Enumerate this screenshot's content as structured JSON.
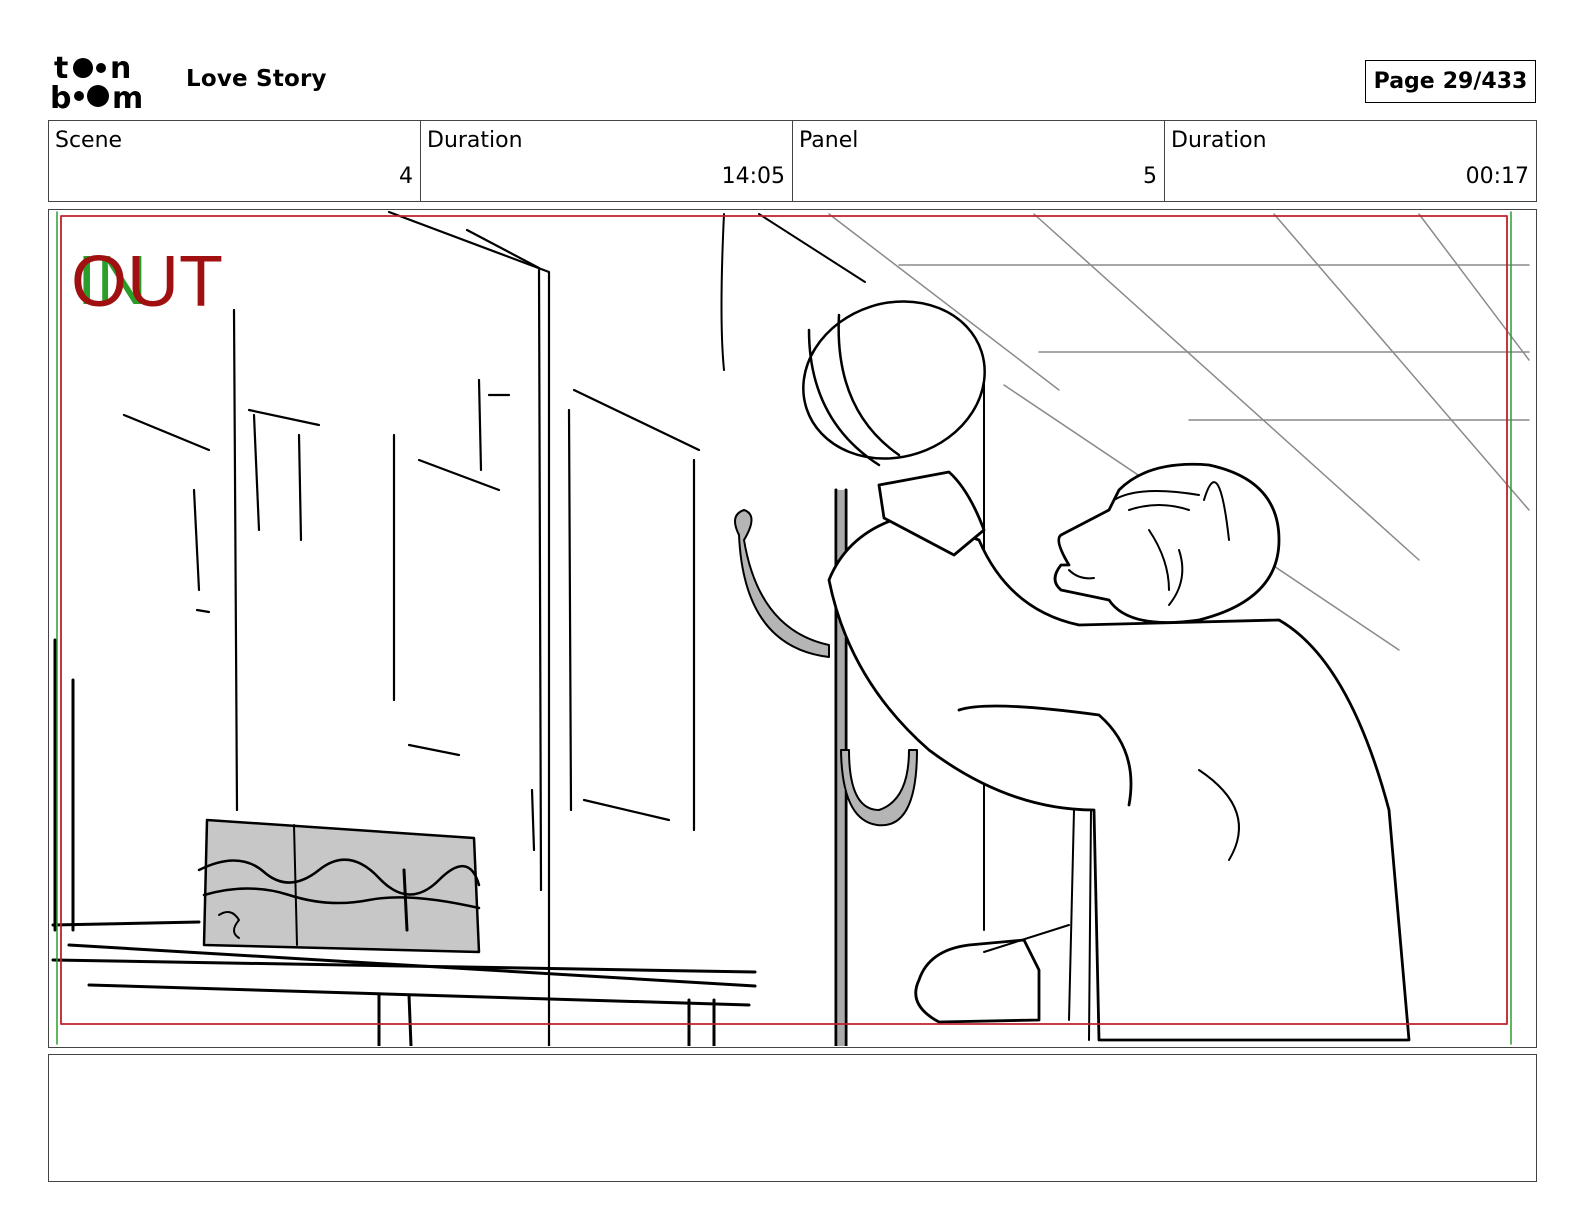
{
  "header": {
    "logo_text": "toon boom",
    "project_title": "Love Story",
    "page_label": "Page",
    "page_number": "29/433"
  },
  "info": {
    "scene_label": "Scene",
    "scene_value": "4",
    "scene_duration_label": "Duration",
    "scene_duration_value": "14:05",
    "panel_label": "Panel",
    "panel_value": "5",
    "panel_duration_label": "Duration",
    "panel_duration_value": "00:17"
  },
  "panel": {
    "in_marker": "IN",
    "out_marker": "OUT",
    "marker_colors": {
      "in": "#2a9d2a",
      "out": "#a01010"
    },
    "safe_frame_color": "#c0202a"
  },
  "notes": {
    "text": ""
  }
}
